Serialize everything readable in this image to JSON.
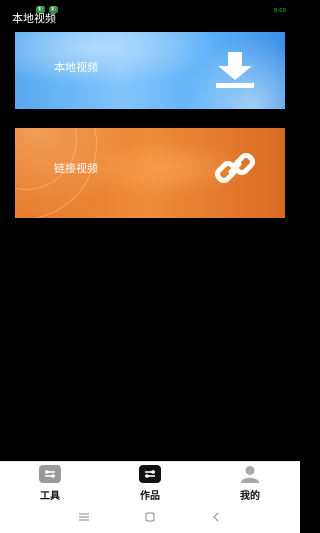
{
  "header": {
    "title": "本地视频",
    "status_text": "8:00"
  },
  "cards": [
    {
      "label": "本地视频",
      "icon": "download-icon",
      "color": "#5aaef6"
    },
    {
      "label": "链接视频",
      "icon": "link-icon",
      "color": "#e67a2c"
    }
  ],
  "bottom_nav": {
    "items": [
      {
        "label": "工具",
        "icon": "tools-icon"
      },
      {
        "label": "作品",
        "icon": "works-icon"
      },
      {
        "label": "我的",
        "icon": "user-icon"
      }
    ]
  },
  "system_nav": [
    "menu-icon",
    "home-icon",
    "back-icon"
  ]
}
